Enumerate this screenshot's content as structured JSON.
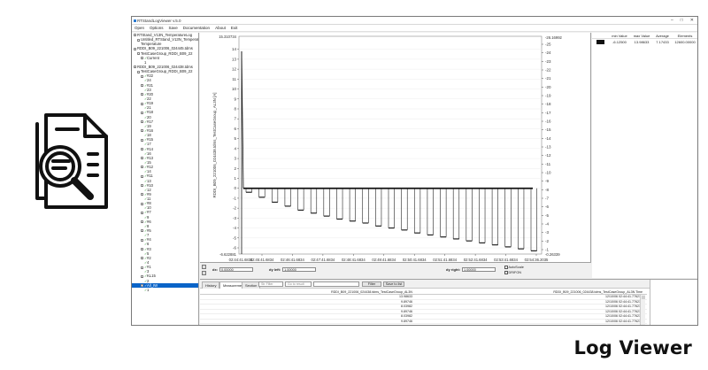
{
  "window": {
    "title": "RTStandLogViewer v.5.0",
    "controls": [
      "–",
      "□",
      "✕"
    ]
  },
  "menu": [
    "Open",
    "Options",
    "Save",
    "Documentation",
    "About",
    "Exit"
  ],
  "tree": [
    {
      "text": "RTStand_V13N_TemperatureLog",
      "indent": 0,
      "exp": "−",
      "check": false
    },
    {
      "text": "Untitled_RTStand_V13N_Temperature",
      "indent": 1,
      "exp": "−",
      "check": false
    },
    {
      "text": "Temperature",
      "indent": 2,
      "exp": "",
      "check": false
    },
    {
      "text": "RDDI_B09_221006_024445.tdms",
      "indent": 0,
      "exp": "−",
      "check": false
    },
    {
      "text": "TestCaseGroup_RDDI_B09_22",
      "indent": 1,
      "exp": "−",
      "check": false
    },
    {
      "text": "Current",
      "indent": 2,
      "exp": "−",
      "check": true
    },
    {
      "text": "1",
      "indent": 3,
      "exp": "",
      "check": false
    },
    {
      "text": "RDDI_B09_221006_024438.tdms",
      "indent": 0,
      "exp": "−",
      "check": false
    },
    {
      "text": "TestCaseGroup_RDDI_B09_22",
      "indent": 1,
      "exp": "−",
      "check": false
    },
    {
      "text": "#22",
      "indent": 2,
      "exp": "−",
      "check": true
    },
    {
      "text": "24",
      "indent": 3,
      "exp": "",
      "check": true
    },
    {
      "text": "#21",
      "indent": 2,
      "exp": "−",
      "check": true
    },
    {
      "text": "23",
      "indent": 3,
      "exp": "",
      "check": true
    },
    {
      "text": "#20",
      "indent": 2,
      "exp": "−",
      "check": true
    },
    {
      "text": "22",
      "indent": 3,
      "exp": "",
      "check": true
    },
    {
      "text": "#19",
      "indent": 2,
      "exp": "−",
      "check": true
    },
    {
      "text": "21",
      "indent": 3,
      "exp": "",
      "check": true
    },
    {
      "text": "#18",
      "indent": 2,
      "exp": "−",
      "check": true
    },
    {
      "text": "20",
      "indent": 3,
      "exp": "",
      "check": true
    },
    {
      "text": "#17",
      "indent": 2,
      "exp": "−",
      "check": true
    },
    {
      "text": "19",
      "indent": 3,
      "exp": "",
      "check": true
    },
    {
      "text": "#16",
      "indent": 2,
      "exp": "−",
      "check": true
    },
    {
      "text": "18",
      "indent": 3,
      "exp": "",
      "check": true
    },
    {
      "text": "#15",
      "indent": 2,
      "exp": "−",
      "check": true
    },
    {
      "text": "17",
      "indent": 3,
      "exp": "",
      "check": true
    },
    {
      "text": "#14",
      "indent": 2,
      "exp": "−",
      "check": true
    },
    {
      "text": "16",
      "indent": 3,
      "exp": "",
      "check": true
    },
    {
      "text": "#13",
      "indent": 2,
      "exp": "−",
      "check": true
    },
    {
      "text": "15",
      "indent": 3,
      "exp": "",
      "check": true
    },
    {
      "text": "#12",
      "indent": 2,
      "exp": "−",
      "check": true
    },
    {
      "text": "14",
      "indent": 3,
      "exp": "",
      "check": true
    },
    {
      "text": "#11",
      "indent": 2,
      "exp": "−",
      "check": true
    },
    {
      "text": "13",
      "indent": 3,
      "exp": "",
      "check": true
    },
    {
      "text": "#10",
      "indent": 2,
      "exp": "−",
      "check": true
    },
    {
      "text": "12",
      "indent": 3,
      "exp": "",
      "check": true
    },
    {
      "text": "#9",
      "indent": 2,
      "exp": "−",
      "check": true
    },
    {
      "text": "11",
      "indent": 3,
      "exp": "",
      "check": true
    },
    {
      "text": "#8",
      "indent": 2,
      "exp": "−",
      "check": true
    },
    {
      "text": "10",
      "indent": 3,
      "exp": "",
      "check": true
    },
    {
      "text": "#7",
      "indent": 2,
      "exp": "−",
      "check": true
    },
    {
      "text": "9",
      "indent": 3,
      "exp": "",
      "check": true
    },
    {
      "text": "#6",
      "indent": 2,
      "exp": "−",
      "check": true
    },
    {
      "text": "8",
      "indent": 3,
      "exp": "",
      "check": true
    },
    {
      "text": "#5",
      "indent": 2,
      "exp": "−",
      "check": true
    },
    {
      "text": "7",
      "indent": 3,
      "exp": "",
      "check": true
    },
    {
      "text": "#4",
      "indent": 2,
      "exp": "−",
      "check": true
    },
    {
      "text": "6",
      "indent": 3,
      "exp": "",
      "check": true
    },
    {
      "text": "#3",
      "indent": 2,
      "exp": "−",
      "check": true
    },
    {
      "text": "5",
      "indent": 3,
      "exp": "",
      "check": true
    },
    {
      "text": "#2",
      "indent": 2,
      "exp": "−",
      "check": true
    },
    {
      "text": "4",
      "indent": 3,
      "exp": "",
      "check": true
    },
    {
      "text": "#1",
      "indent": 2,
      "exp": "−",
      "check": true
    },
    {
      "text": "3",
      "indent": 3,
      "exp": "",
      "check": true
    },
    {
      "text": "KL15",
      "indent": 2,
      "exp": "−",
      "check": true
    },
    {
      "text": "2",
      "indent": 3,
      "exp": "",
      "check": true
    },
    {
      "text": "All_IW",
      "indent": 2,
      "exp": "−",
      "check": true,
      "selected": true
    },
    {
      "text": "1",
      "indent": 3,
      "exp": "",
      "check": true
    }
  ],
  "chart_data": {
    "type": "line",
    "ylabel_left": "RDDI_B09_221006_024438.tdms_TestCaseGroup_AL3N [A]",
    "xlabel": "Time",
    "y_left_top_label": "15.310734",
    "y_left_bottom_label": "-6.622881",
    "y_right_top_label": "-26.16992",
    "y_right_bottom_label": "-0.26339",
    "y_left_ticks": [
      14,
      13,
      12,
      11,
      10,
      9,
      8,
      7,
      6,
      5,
      4,
      3,
      2,
      1,
      0,
      -1,
      -2,
      -3,
      -4,
      -5,
      -6
    ],
    "y_right_ticks": [
      -25,
      -24,
      -23,
      -22,
      -21,
      -20,
      -19,
      -18,
      -17,
      -16,
      -15,
      -14,
      -13,
      -12,
      -11,
      -10,
      -9,
      -8,
      -7,
      -6,
      -5,
      -4,
      -3,
      -2,
      -1
    ],
    "ylim_left": [
      -6.622881,
      15.310734
    ],
    "x_ticks": [
      {
        "time": "02:45:41.6834",
        "date": "06/10/2022"
      },
      {
        "time": "02:46:41.6834",
        "date": "06/10/2022"
      },
      {
        "time": "02:47:41.6834",
        "date": "06/10/2022"
      },
      {
        "time": "02:48:41.6834",
        "date": "06/10/2022"
      },
      {
        "time": "02:49:41.6834",
        "date": "06/10/2022"
      },
      {
        "time": "02:50:41.6834",
        "date": "06/10/2022"
      },
      {
        "time": "02:51:41.6834",
        "date": "06/10/2022"
      },
      {
        "time": "02:52:41.6834",
        "date": "06/10/2022"
      },
      {
        "time": "02:53:41.6834",
        "date": "06/10/2022"
      },
      {
        "time": "02:54:36.2035",
        "date": "06/10/2022"
      }
    ],
    "x_start_label": "02:44:41.6834\n06/10/2022",
    "baseline_level": 0,
    "pulse_lows": [
      -0.4,
      -0.9,
      -1.4,
      -1.8,
      -2.2,
      -2.5,
      -2.8,
      -3.1,
      -3.3,
      -3.5,
      -3.8,
      -4.0,
      -4.2,
      -4.5,
      -4.7,
      -4.9,
      -5.1,
      -5.3,
      -5.5,
      -5.7,
      -5.9,
      -6.1,
      -6.3
    ],
    "initial_spike": 13.8,
    "grid": true
  },
  "stats": {
    "headers": [
      "min Value",
      "max Value",
      "Average",
      "Elements"
    ],
    "row": [
      "-6.12500",
      "13.98633",
      "7.17433",
      "12600.00000"
    ]
  },
  "zoom": {
    "dx_label": "dx:",
    "dx_value": "0.00000",
    "dy_left_label": "dy left:",
    "dy_left_value": "1.00000",
    "dy_right_label": "dy right:",
    "dy_right_value": "1.00000",
    "autoscale": "AutoScale",
    "drifton": "DRIFON"
  },
  "bottom": {
    "tabs": [
      "History",
      "Measurement",
      "Section"
    ],
    "filter_placeholder": "Str Filter",
    "goto_placeholder": "Go to result",
    "filter_btn": "Filter",
    "save_btn": "Save to list",
    "col1_header": "RDDI_B09_221006_024438.tdms_TestCaseGroup_AL3N",
    "col2_header": "RDDI_B09_221006_024438.tdms_TestCaseGroup_AL3N Time",
    "rows": [
      [
        "13.98633",
        "12/10/06 02:44:41.776215"
      ],
      [
        "9.89746",
        "12/10/06 02:44:41.776215"
      ],
      [
        "8.03982",
        "12/10/06 02:44:41.776215"
      ],
      [
        "9.89746",
        "12/10/06 02:44:41.776215"
      ],
      [
        "8.03982",
        "12/10/06 02:44:41.776215"
      ],
      [
        "9.89746",
        "12/10/06 02:44:41.776215"
      ]
    ]
  },
  "caption": "Log Viewer"
}
